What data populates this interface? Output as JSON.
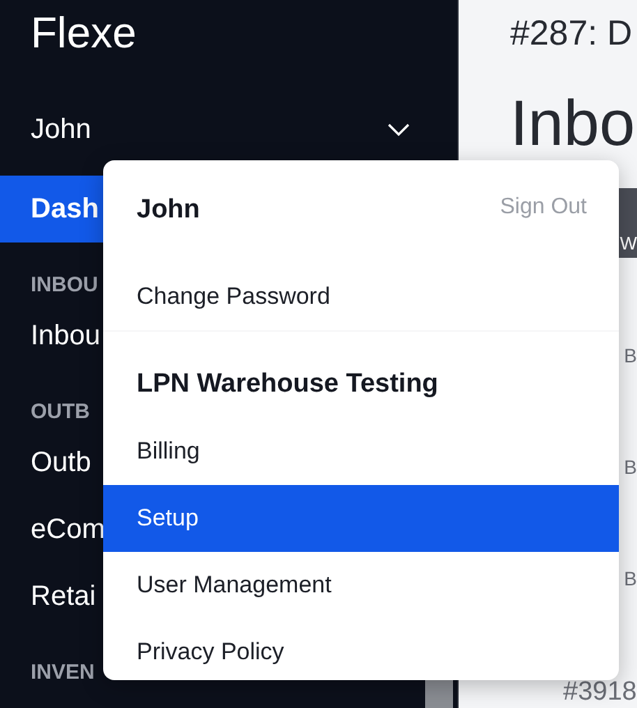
{
  "sidebar": {
    "logo": "Flexe",
    "user": {
      "name": "John"
    },
    "entries": [
      {
        "kind": "item",
        "label": "Dash",
        "selected": true
      },
      {
        "kind": "heading",
        "label": "INBOU"
      },
      {
        "kind": "item",
        "label": "Inbou",
        "selected": false
      },
      {
        "kind": "heading",
        "label": "OUTB"
      },
      {
        "kind": "item",
        "label": "Outb",
        "selected": false
      },
      {
        "kind": "item",
        "label": "eCom",
        "selected": false
      },
      {
        "kind": "item",
        "label": "Retai",
        "selected": false
      },
      {
        "kind": "heading",
        "label": "INVEN"
      }
    ]
  },
  "main": {
    "title": "#287: D",
    "heading": "Inbo",
    "header_bar_text": "W",
    "row_texts": [
      "B",
      "B",
      "B"
    ],
    "bottom_text": "#3918"
  },
  "user_menu": {
    "name": "John",
    "sign_out": "Sign Out",
    "account_items": [
      {
        "label": "Change Password",
        "selected": false
      }
    ],
    "org_name": "LPN Warehouse Testing",
    "org_items": [
      {
        "label": "Billing",
        "selected": false
      },
      {
        "label": "Setup",
        "selected": true
      },
      {
        "label": "User Management",
        "selected": false
      },
      {
        "label": "Privacy Policy",
        "selected": false
      }
    ]
  }
}
